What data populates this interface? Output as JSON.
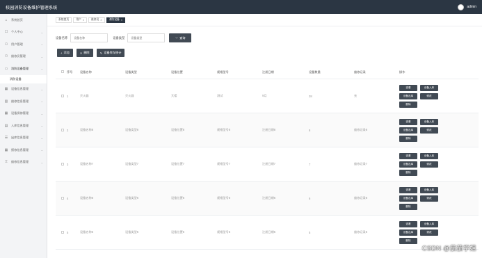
{
  "app": {
    "title": "校园消防设备维护管理系统",
    "user": "admin"
  },
  "sidebar": {
    "items": [
      {
        "label": "系统首页",
        "icon": "home-icon",
        "glyph": "⌂",
        "chevron": false
      },
      {
        "label": "个人中心",
        "icon": "user-icon",
        "glyph": "☐",
        "chevron": true
      },
      {
        "label": "用户管理",
        "icon": "user-icon",
        "glyph": "⚇",
        "chevron": true
      },
      {
        "label": "维修员管理",
        "icon": "user-icon",
        "glyph": "⚇",
        "chevron": true
      },
      {
        "label": "消防设备管理",
        "icon": "monitor-icon",
        "glyph": "▭",
        "chevron": true,
        "open": true,
        "sub": [
          "消防设备"
        ]
      },
      {
        "label": "设备信息管理",
        "icon": "grid-icon",
        "glyph": "▦",
        "chevron": true
      },
      {
        "label": "维修信息管理",
        "icon": "chart-icon",
        "glyph": "▥",
        "chevron": true
      },
      {
        "label": "设备保修管理",
        "icon": "grid-icon",
        "glyph": "▦",
        "chevron": true
      },
      {
        "label": "入库信息管理",
        "icon": "inbox-icon",
        "glyph": "▤",
        "chevron": true
      },
      {
        "label": "出库信息管理",
        "icon": "sliders-icon",
        "glyph": "☰",
        "chevron": true
      },
      {
        "label": "报修信息管理",
        "icon": "grid-icon",
        "glyph": "▦",
        "chevron": true
      },
      {
        "label": "维修信息管理",
        "icon": "trophy-icon",
        "glyph": "♖",
        "chevron": true
      }
    ]
  },
  "tabs": [
    {
      "label": "系统首页",
      "active": false
    },
    {
      "label": "用户",
      "active": false,
      "close": "×"
    },
    {
      "label": "维修员",
      "active": false,
      "close": "×"
    },
    {
      "label": "消防设备",
      "active": true,
      "close": "×"
    }
  ],
  "search": {
    "name_label": "设备名称",
    "name_placeholder": "设备名称",
    "type_label": "设备类型",
    "type_placeholder": "设备类型",
    "button": "查询"
  },
  "actions": {
    "add": "添加",
    "delete": "删除",
    "stats": "设备库存统计"
  },
  "table": {
    "headers": [
      "序号",
      "设备名称",
      "设备类型",
      "设备位置",
      "规格型号",
      "注册日期",
      "设备数量",
      "维修记录",
      "操作"
    ],
    "rows": [
      {
        "idx": "1",
        "name": "灭火器",
        "type": "灭火器",
        "loc": "大楼",
        "model": "测试",
        "date": "9月",
        "count": "38",
        "rec": "无"
      },
      {
        "idx": "2",
        "name": "设备名称8",
        "type": "设备类型8",
        "loc": "设备位置8",
        "model": "规格型号8",
        "date": "注册日期8",
        "count": "8",
        "rec": "维修记录8"
      },
      {
        "idx": "3",
        "name": "设备名称7",
        "type": "设备类型7",
        "loc": "设备位置7",
        "model": "规格型号7",
        "date": "注册日期7",
        "count": "7",
        "rec": "维修记录7"
      },
      {
        "idx": "4",
        "name": "设备名称6",
        "type": "设备类型6",
        "loc": "设备位置6",
        "model": "规格型号6",
        "date": "注册日期6",
        "count": "6",
        "rec": "维修记录6"
      },
      {
        "idx": "5",
        "name": "设备名称5",
        "type": "设备类型5",
        "loc": "设备位置5",
        "model": "规格型号5",
        "date": "注册日期5",
        "count": "5",
        "rec": "维修记录5"
      }
    ],
    "op_buttons": {
      "view": "查看",
      "in": "设备入库",
      "out": "设备出库",
      "edit": "修改",
      "del": "删除"
    }
  },
  "watermark": "CSDN @茄茄学姐",
  "colors": {
    "topbar": "#2b3643",
    "button": "#414a54",
    "sidebar": "#f3f4f6"
  }
}
